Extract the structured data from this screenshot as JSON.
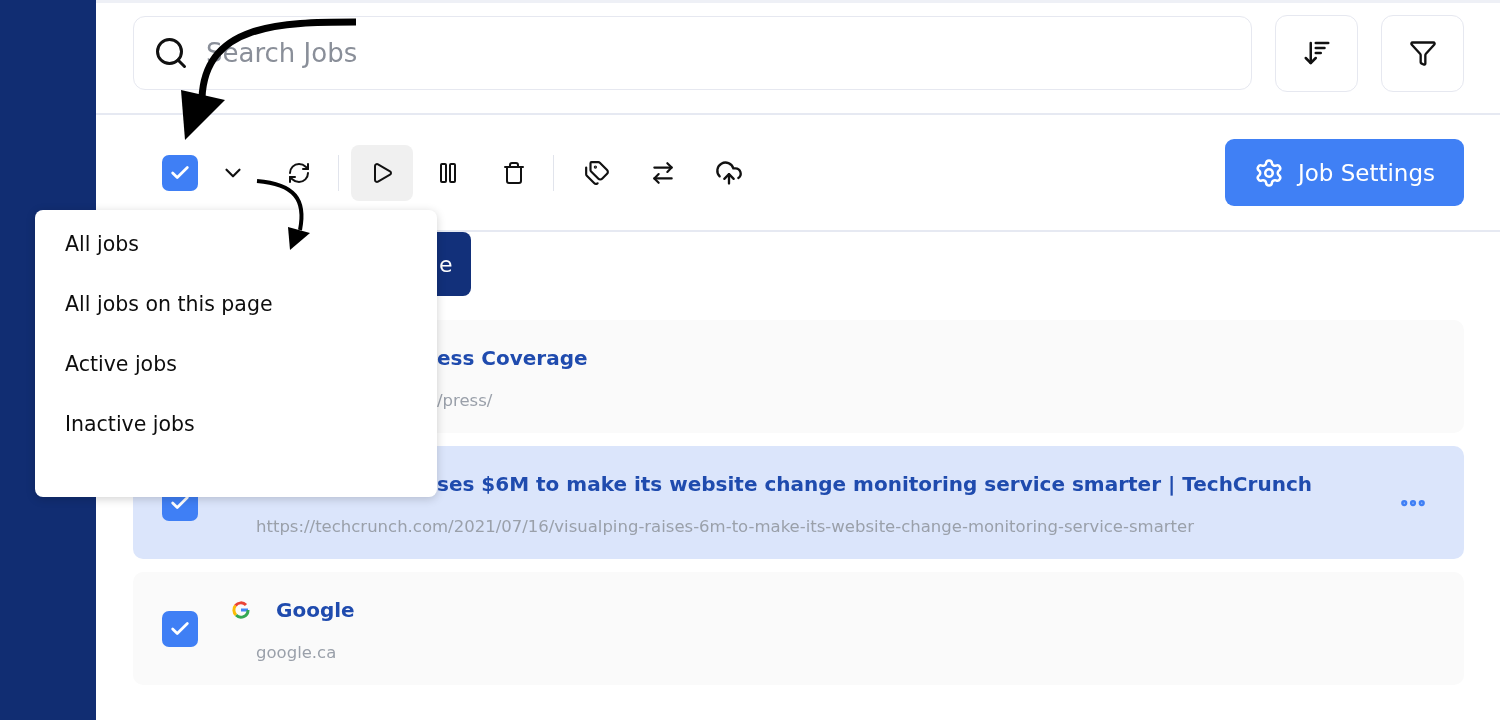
{
  "search": {
    "placeholder": "Search Jobs"
  },
  "toolbar": {
    "checked": true,
    "play_highlighted": true
  },
  "settings_button": {
    "label": "Job Settings"
  },
  "covered_button": {
    "label": "e"
  },
  "menu": {
    "items": [
      "All jobs",
      "All jobs on this page",
      "Active jobs",
      "Inactive jobs"
    ]
  },
  "jobs": [
    {
      "kind": "covered",
      "selected": false,
      "title": "ess Coverage",
      "url": "/press/"
    },
    {
      "kind": "half",
      "selected": true,
      "checked": true,
      "title": "ses $6M to make its website change monitoring service smarter | TechCrunch",
      "url": "https://techcrunch.com/2021/07/16/visualping-raises-6m-to-make-its-website-change-monitoring-service-smarter"
    },
    {
      "kind": "plain",
      "selected": false,
      "checked": true,
      "title": "Google",
      "url": "google.ca"
    }
  ]
}
